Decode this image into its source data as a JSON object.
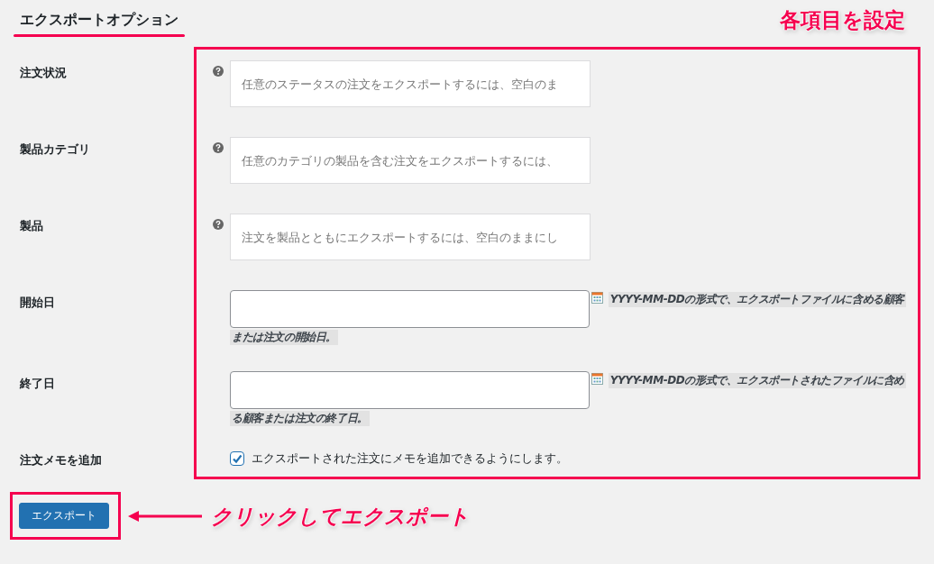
{
  "title": "エクスポートオプション",
  "annotations": {
    "settings_note": "各項目を設定",
    "button_note": "クリックしてエクスポート"
  },
  "fields": [
    {
      "kind": "select",
      "label": "注文状況",
      "placeholder": "任意のステータスの注文をエクスポートするには、空白のま"
    },
    {
      "kind": "select",
      "label": "製品カテゴリ",
      "placeholder": "任意のカテゴリの製品を含む注文をエクスポートするには、"
    },
    {
      "kind": "select",
      "label": "製品",
      "placeholder": "注文を製品とともにエクスポートするには、空白のままにし"
    },
    {
      "kind": "date",
      "label": "開始日",
      "description_lines": [
        "YYYY-MM-DDの形式で、エクスポートファイルに含める顧客",
        "または注文の開始日。"
      ]
    },
    {
      "kind": "date",
      "label": "終了日",
      "description_lines": [
        "YYYY-MM-DDの形式で、エクスポートされたファイルに含め",
        "る顧客または注文の終了日。"
      ]
    },
    {
      "kind": "checkbox",
      "label": "注文メモを追加",
      "text": "エクスポートされた注文にメモを追加できるようにします。",
      "checked": true
    }
  ],
  "button": "エクスポート"
}
